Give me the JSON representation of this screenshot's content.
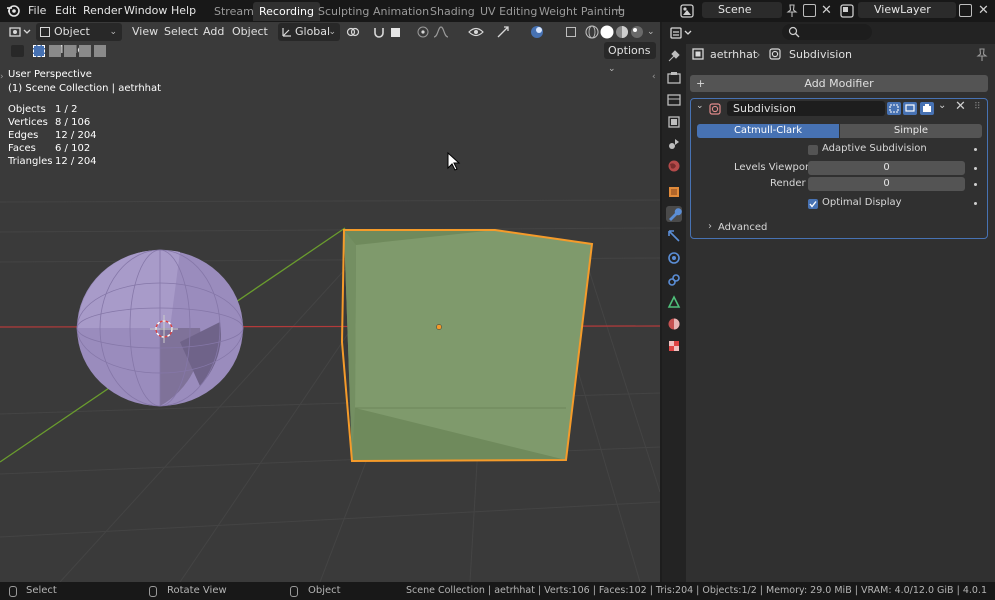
{
  "menu": {
    "items": [
      "File",
      "Edit",
      "Render",
      "Window",
      "Help"
    ]
  },
  "workspaces": {
    "tabs": [
      "Stream",
      "Recording",
      "Sculpting",
      "Animation",
      "Shading",
      "UV Editing",
      "Weight Painting"
    ],
    "active": "Recording",
    "add_label": "+"
  },
  "scene": {
    "name": "Scene"
  },
  "view_layer": {
    "name": "ViewLayer"
  },
  "viewport": {
    "mode": "Object Mode",
    "menus": [
      "View",
      "Select",
      "Add",
      "Object"
    ],
    "orientation": "Global",
    "options_label": "Options",
    "overlay": {
      "perspective": "User Perspective",
      "collection": "(1) Scene Collection | aetrhhat"
    },
    "stats": {
      "objects_label": "Objects",
      "objects": "1 / 2",
      "vertices_label": "Vertices",
      "vertices": "8 / 106",
      "edges_label": "Edges",
      "edges": "12 / 204",
      "faces_label": "Faces",
      "faces": "6 / 102",
      "triangles_label": "Triangles",
      "triangles": "12 / 204"
    }
  },
  "properties": {
    "breadcrumb_object": "aetrhhat",
    "breadcrumb_modifier": "Subdivision",
    "add_modifier": "Add Modifier",
    "modifier": {
      "name": "Subdivision",
      "type_options": [
        "Catmull-Clark",
        "Simple"
      ],
      "selected_type": "Catmull-Clark",
      "adaptive_label": "Adaptive Subdivision",
      "adaptive": false,
      "levels_viewport_label": "Levels Viewport",
      "levels_viewport": "0",
      "render_label": "Render",
      "render": "0",
      "optimal_label": "Optimal Display",
      "optimal": true,
      "advanced_label": "Advanced"
    }
  },
  "statusbar": {
    "select": "Select",
    "rotate": "Rotate View",
    "object": "Object",
    "info": "Scene Collection | aetrhhat | Verts:106 | Faces:102 | Tris:204 | Objects:1/2 | Memory: 29.0 MiB | VRAM: 4.0/12.0 GiB | 4.0.1"
  },
  "colors": {
    "accent": "#4772b3",
    "selection_outline": "#f59b2a",
    "cube_face": "#7f9a6c",
    "sphere": "#9a8cbd",
    "x_axis": "#b33a3a",
    "y_axis": "#6a9c2e"
  },
  "icons": {
    "blender_logo": "blender-logo-icon",
    "editor_type": "editor-type-icon",
    "mouse_cursor": "mouse-cursor-icon"
  }
}
